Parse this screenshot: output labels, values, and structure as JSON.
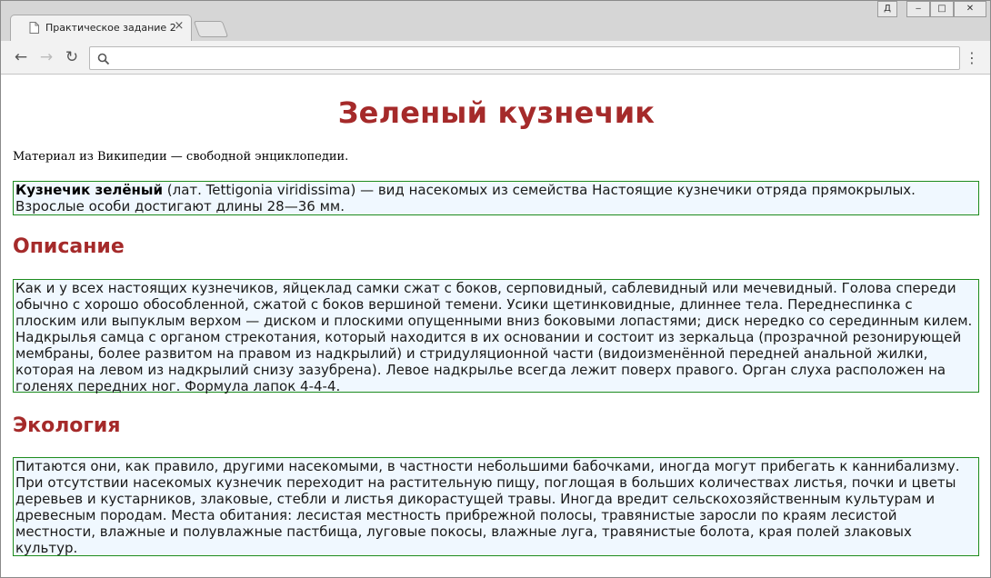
{
  "browser": {
    "tab_title": "Практическое задание 2",
    "tab_close": "×",
    "window_buttons": {
      "user": "Д",
      "minimize": "‒",
      "maximize": "□",
      "close": "✕"
    },
    "nav": {
      "back": "←",
      "forward": "→",
      "reload": "↻",
      "menu": "⋮"
    },
    "address_value": "",
    "icons": [
      "page-icon",
      "search-icon"
    ]
  },
  "page": {
    "title": "Зеленый кузнечик",
    "source": "Материал из Википедии — свободной энциклопедии.",
    "intro": {
      "bold": "Кузнечик зелёный",
      "rest": " (лат. Tettigonia viridissima) — вид насекомых из семейства Настоящие кузнечики отряда прямокрылых. Взрослые особи достигают длины 28—36 мм."
    },
    "sections": [
      {
        "heading": "Описание",
        "text": "Как и у всех настоящих кузнечиков, яйцеклад самки сжат с боков, серповидный, саблевидный или мечевидный. Голова спереди обычно с хорошо обособленной, сжатой с боков вершиной темени. Усики щетинковидные, длиннее тела. Переднеспинка с плоским или выпуклым верхом — диском и плоскими опущенными вниз боковыми лопастями; диск нередко со серединным килем. Надкрылья самца с органом стрекотания, который находится в их основании и состоит из зеркальца (прозрачной резонирующей мембраны, более развитом на правом из надкрылий) и стридуляционной части (видоизменённой передней анальной жилки, которая на левом из надкрылий снизу зазубрена). Левое надкрылье всегда лежит поверх правого. Орган слуха расположен на голенях передних ног. Формула лапок 4-4-4."
      },
      {
        "heading": "Экология",
        "text": "Питаются они, как правило, другими насекомыми, в частности небольшими бабочками, иногда могут прибегать к каннибализму. При отсутствии насекомых кузнечик переходит на растительную пищу, поглощая в больших количествах листья, почки и цветы деревьев и кустарников, злаковые, стебли и листья дикорастущей травы. Иногда вредит сельскохозяйственным культурам и древесным породам. Места обитания: лесистая местность прибрежной полосы, травянистые заросли по краям лесистой местности, влажные и полувлажные пастбища, луговые покосы, влажные луга, травянистые болота, края полей злаковых культур."
      }
    ],
    "colors": {
      "heading": "#a52a2a",
      "box_border": "#1e8c1e",
      "box_bg": "#f0f8ff"
    }
  }
}
